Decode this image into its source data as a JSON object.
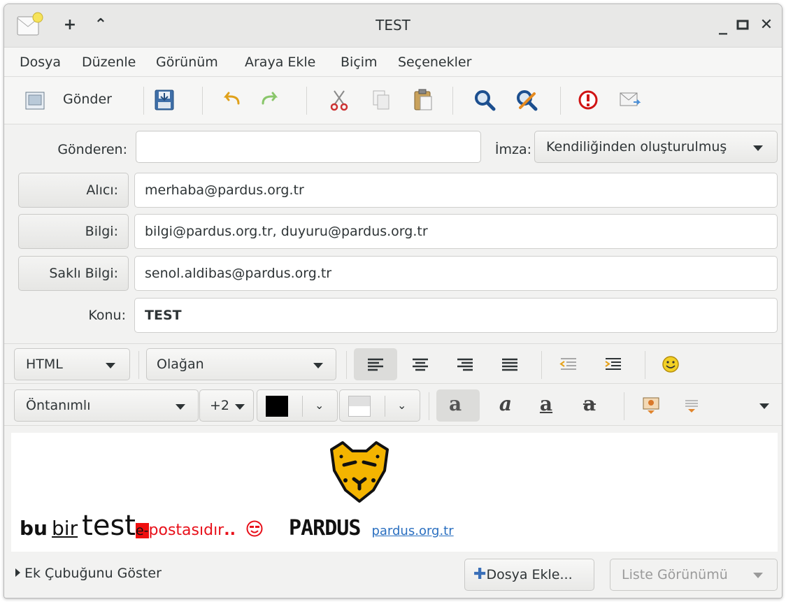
{
  "window": {
    "title": "TEST"
  },
  "menubar": {
    "items": [
      "Dosya",
      "Düzenle",
      "Görünüm",
      "Araya Ekle",
      "Biçim",
      "Seçenekler"
    ]
  },
  "toolbar": {
    "send_label": "Gönder",
    "icons": [
      "send-icon",
      "save-icon",
      "undo-icon",
      "redo-icon",
      "cut-icon",
      "copy-icon",
      "paste-icon",
      "find-icon",
      "replace-icon",
      "priority-icon",
      "receipt-icon"
    ]
  },
  "header": {
    "from_label": "Gönderen:",
    "from_value": "",
    "signature_label": "İmza:",
    "signature_value": "Kendiliğinden oluşturulmuş",
    "to_label": "Alıcı:",
    "to_value": "merhaba@pardus.org.tr",
    "cc_label": "Bilgi:",
    "cc_value": "bilgi@pardus.org.tr, duyuru@pardus.org.tr",
    "bcc_label": "Saklı Bilgi:",
    "bcc_value": "senol.aldibas@pardus.org.tr",
    "subject_label": "Konu:",
    "subject_value": "TEST"
  },
  "format": {
    "mode": "HTML",
    "paragraph_style": "Olağan",
    "font": "Öntanımlı",
    "size": "+2",
    "text_color": "#000000"
  },
  "editor": {
    "words": [
      "bu",
      "bir",
      "test",
      "e-",
      "postasıdır",
      "..",
      "pardus.org.tr"
    ],
    "logo_text": "PARDUS"
  },
  "bottom": {
    "attachment_toggle": "Ek Çubuğunu Göster",
    "add_file": "Dosya Ekle...",
    "view_mode": "Liste Görünümü"
  }
}
